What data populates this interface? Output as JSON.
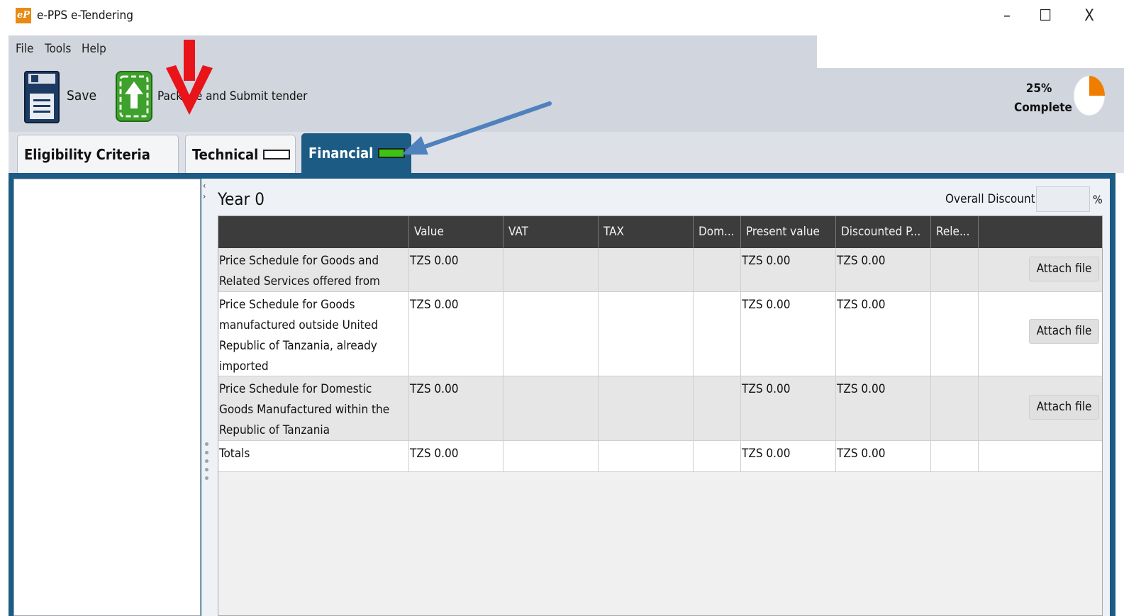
{
  "window": {
    "title": "e-PPS e-Tendering",
    "logo_text": "eP",
    "minimize_icon": "–",
    "maximize_icon": "☐",
    "close_icon": "X"
  },
  "menu": {
    "items": [
      "File",
      "Tools",
      "Help"
    ]
  },
  "toolbar": {
    "save_label": "Save",
    "submit_label": "Package and Submit tender",
    "progress_percent": "25%",
    "progress_text": "Complete",
    "progress_fraction": 0.25,
    "icons": {
      "save": "floppy-disk-icon",
      "submit": "upload-package-icon"
    }
  },
  "tabs": [
    {
      "label": "Eligibility Criteria",
      "status": "partial"
    },
    {
      "label": "Technical",
      "status": "empty"
    },
    {
      "label": "Financial",
      "status": "complete",
      "active": true
    }
  ],
  "financial": {
    "year_title": "Year 0",
    "overall_discount_label": "Overall Discount",
    "overall_discount_value": "",
    "percent_sign": "%",
    "columns": [
      "",
      "Value",
      "VAT",
      "TAX",
      "Dom...",
      "Present value",
      "Discounted P...",
      "Rele...",
      ""
    ],
    "rows": [
      {
        "description": "Price Schedule for Goods and Related Services offered from abroad",
        "value": "TZS 0.00",
        "present_value": "TZS 0.00",
        "discounted": "TZS 0.00",
        "action": "Attach file"
      },
      {
        "description": "Price Schedule for Goods manufactured outside United Republic of Tanzania, already imported",
        "value": "TZS 0.00",
        "present_value": "TZS 0.00",
        "discounted": "TZS 0.00",
        "action": "Attach file"
      },
      {
        "description": "Price Schedule for Domestic Goods Manufactured within the Republic of Tanzania",
        "value": "TZS 0.00",
        "present_value": "TZS 0.00",
        "discounted": "TZS 0.00",
        "action": "Attach file"
      }
    ],
    "totals": {
      "label": "Totals",
      "value": "TZS 0.00",
      "present_value": "TZS 0.00",
      "discounted": "TZS 0.00"
    }
  },
  "colors": {
    "accent": "#1c5b84",
    "toolbar_bg": "#d0d5de",
    "header_bg": "#3c3c3c",
    "complete_green": "#3ec214",
    "progress_orange": "#f07d00",
    "annotation_red": "#e8141a",
    "annotation_blue": "#4f81bd"
  }
}
